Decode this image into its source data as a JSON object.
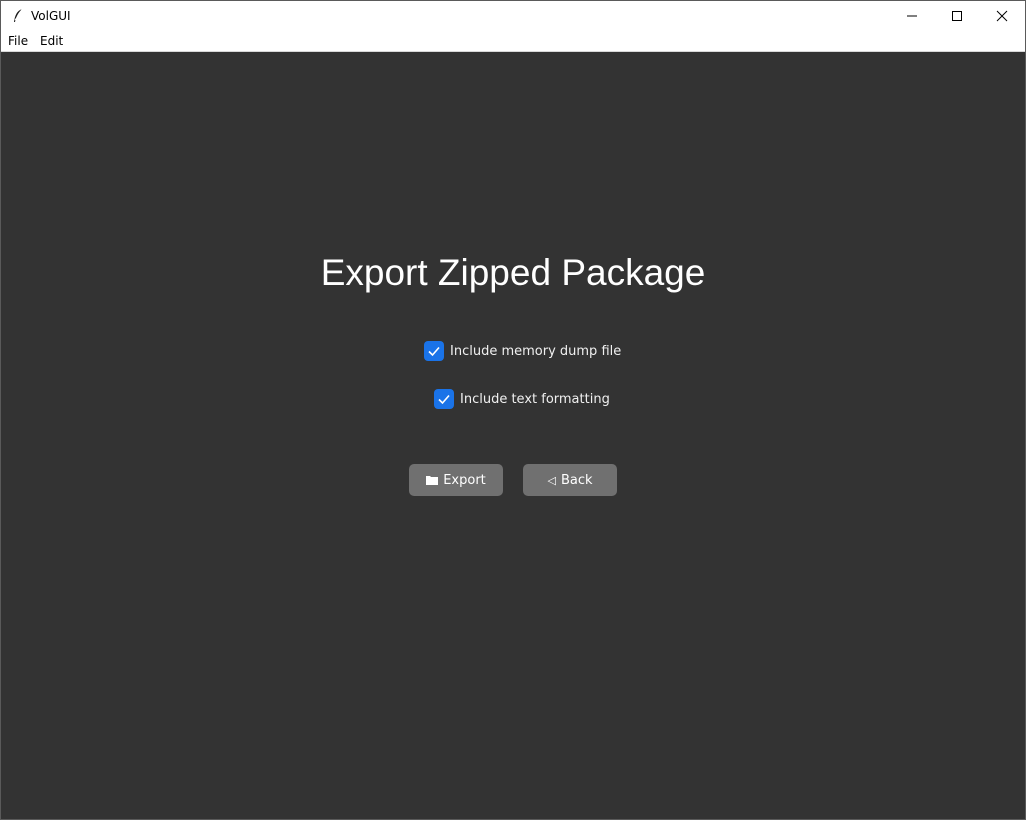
{
  "window": {
    "title": "VolGUI",
    "controls": {
      "minimize": "–",
      "maximize": "☐",
      "close": "✕"
    }
  },
  "menu": {
    "file": "File",
    "edit": "Edit"
  },
  "main": {
    "heading": "Export Zipped Package",
    "options": [
      {
        "label": "Include memory dump file",
        "checked": true
      },
      {
        "label": "Include text formatting",
        "checked": true
      }
    ],
    "buttons": {
      "export": {
        "icon": "folder-icon",
        "label": "Export"
      },
      "back": {
        "icon": "back-triangle-icon",
        "glyph": "◁",
        "label": "Back"
      }
    }
  },
  "colors": {
    "background": "#333333",
    "checkbox": "#1a73e8",
    "button": "#707070",
    "text": "#ffffff"
  }
}
